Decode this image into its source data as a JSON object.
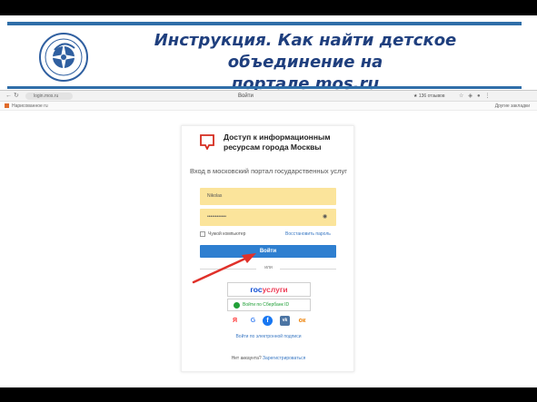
{
  "slide": {
    "title_line1": "Инструкция. Как найти детское объединение на",
    "title_line2_prefix": "портале ",
    "title_link": "mos.ru"
  },
  "browser": {
    "url": "login.mos.ru",
    "tab_title": "Войти",
    "reviews": "★ 136 отзывов",
    "bookmark": "Нарисованное ru",
    "other_bookmarks": "Другие закладки",
    "icons": [
      "back-icon",
      "forward-icon",
      "reload-icon",
      "lock-icon",
      "star-icon",
      "extension-icon",
      "profile-icon",
      "menu-icon"
    ]
  },
  "card": {
    "heading": "Доступ к информационным ресурсам города Москвы",
    "subheading": "Вход в московский портал государственных услуг",
    "login_value": "Nikolas",
    "password_value": "••••••••••••",
    "remember_label": "Чужой компьютер",
    "forgot_link": "Восстановить пароль",
    "login_button": "Войти",
    "or_label": "или",
    "gosuslugi_part1": "гос",
    "gosuslugi_part2": "услуги",
    "sber_button": "Войти по Сбербанк ID",
    "social": {
      "yandex": "Я",
      "google": "G",
      "facebook": "f",
      "vk": "vk",
      "ok": "ок"
    },
    "esign_link": "Войти по электронной подписи",
    "no_account": "Нет аккаунта?",
    "register_link": "Зарегистрироваться"
  },
  "colors": {
    "accent": "#2f6ea8",
    "title": "#1f3f7e",
    "field_bg": "#fbe49b",
    "button_blue": "#2e7fd0",
    "arrow": "#e0312a",
    "mos_red": "#d52b1e"
  }
}
